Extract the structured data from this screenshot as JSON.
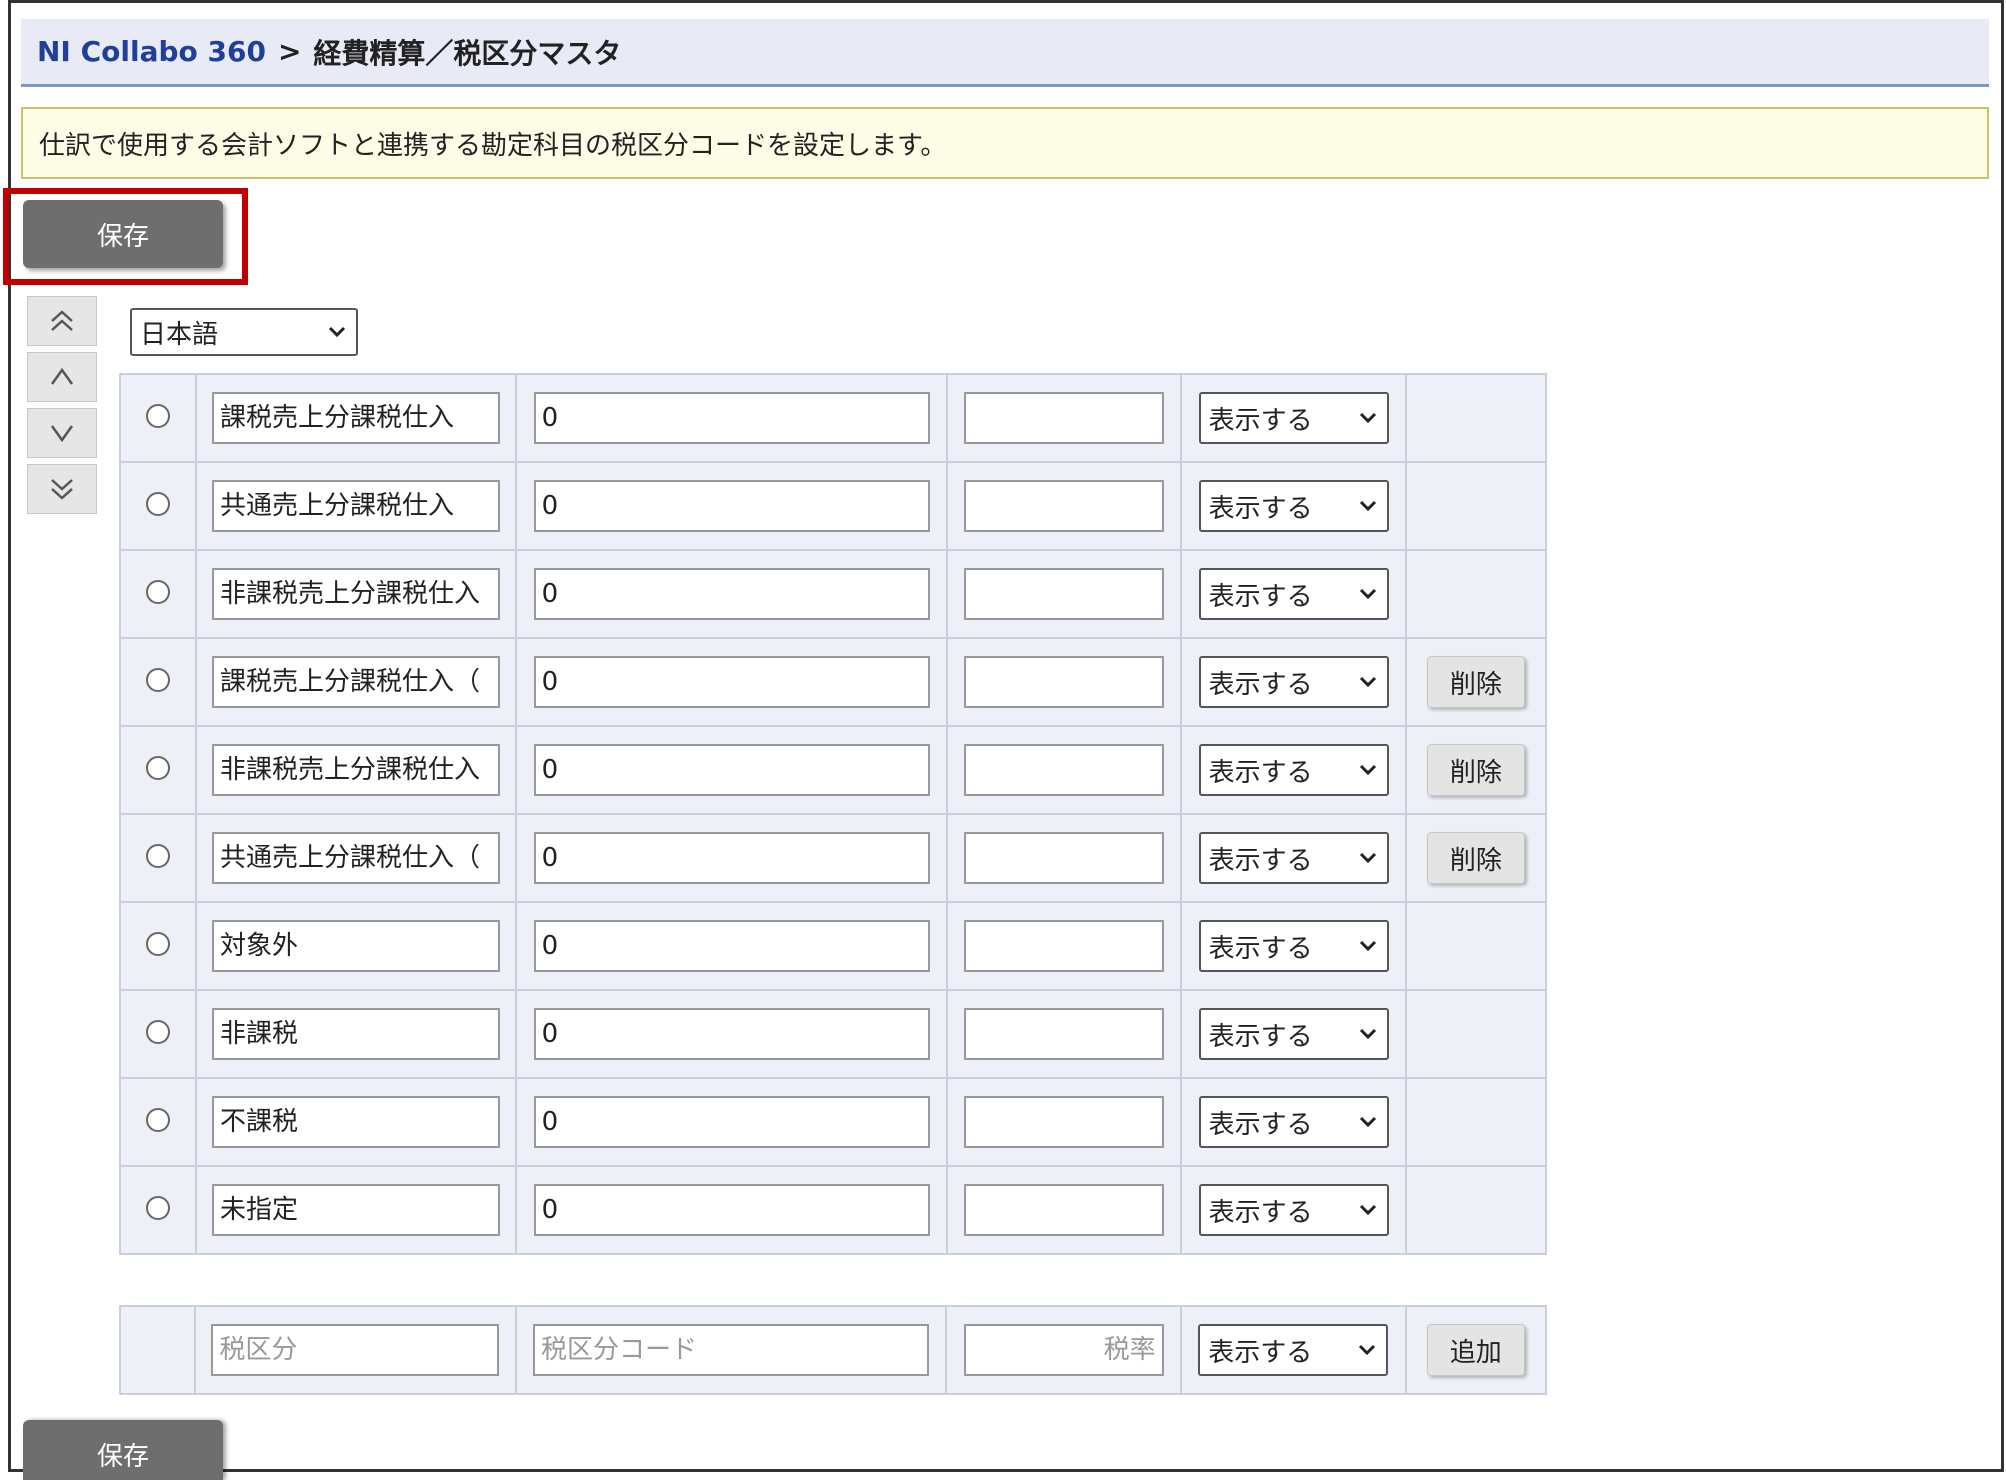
{
  "breadcrumb": {
    "app": "NI Collabo 360",
    "separator": ">",
    "page": "経費精算／税区分マスタ"
  },
  "description": "仕訳で使用する会計ソフトと連携する勘定科目の税区分コードを設定します。",
  "save_label": "保存",
  "move_buttons": [
    "chevrons-up-icon",
    "chevron-up-icon",
    "chevron-down-icon",
    "chevrons-down-icon"
  ],
  "language_select": {
    "value": "日本語"
  },
  "rows": [
    {
      "name": "課税売上分課税仕入",
      "code": "0",
      "rate": "",
      "display": "表示する",
      "action": ""
    },
    {
      "name": "共通売上分課税仕入",
      "code": "0",
      "rate": "",
      "display": "表示する",
      "action": ""
    },
    {
      "name": "非課税売上分課税仕入",
      "code": "0",
      "rate": "",
      "display": "表示する",
      "action": ""
    },
    {
      "name": "課税売上分課税仕入（",
      "code": "0",
      "rate": "",
      "display": "表示する",
      "action": "削除"
    },
    {
      "name": "非課税売上分課税仕入",
      "code": "0",
      "rate": "",
      "display": "表示する",
      "action": "削除"
    },
    {
      "name": "共通売上分課税仕入（",
      "code": "0",
      "rate": "",
      "display": "表示する",
      "action": "削除"
    },
    {
      "name": "対象外",
      "code": "0",
      "rate": "",
      "display": "表示する",
      "action": ""
    },
    {
      "name": "非課税",
      "code": "0",
      "rate": "",
      "display": "表示する",
      "action": ""
    },
    {
      "name": "不課税",
      "code": "0",
      "rate": "",
      "display": "表示する",
      "action": ""
    },
    {
      "name": "未指定",
      "code": "0",
      "rate": "",
      "display": "表示する",
      "action": ""
    }
  ],
  "add_row": {
    "name_placeholder": "税区分",
    "code_placeholder": "税区分コード",
    "rate_placeholder": "税率",
    "display": "表示する",
    "add_label": "追加"
  }
}
